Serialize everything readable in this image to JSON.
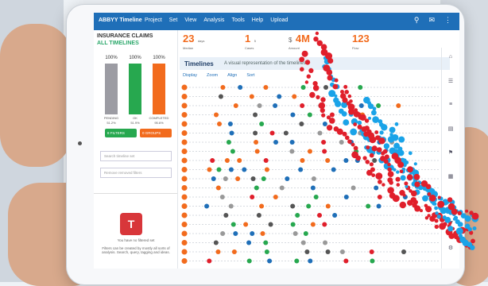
{
  "app": {
    "brand": "ABBYY Timeline",
    "menu": [
      "Project",
      "Set",
      "View",
      "Analysis",
      "Tools",
      "Help",
      "Upload"
    ]
  },
  "left_panel": {
    "title": "INSURANCE CLAIMS",
    "subtitle": "ALL TIMELINES",
    "bars": [
      {
        "pct": "100%",
        "label": "PENDING",
        "count": "51.2%",
        "color": "#9c9ca3",
        "fill": 1.0
      },
      {
        "pct": "100%",
        "label": "OK",
        "count": "51.9%",
        "color": "#27a84f",
        "fill": 1.0
      },
      {
        "pct": "100%",
        "label": "COMPLETED",
        "count": "95.6%",
        "color": "#f26b1d",
        "fill": 1.0
      }
    ],
    "filter_buttons": [
      {
        "label": "8 FILTERS",
        "color": "#27a84f"
      },
      {
        "label": "0 GROUPS",
        "color": "#f26b1d"
      }
    ],
    "search_placeholder": "Search timeline set",
    "remove_label": "Remove removed filters",
    "filter_note_title": "You have no filtered set",
    "filter_note_body": "Filters can be created by mostly all sorts of analysis. Search, query, tagging and ideas."
  },
  "kpis": [
    {
      "value": "23",
      "sub1": "days",
      "sub2": "AVG",
      "color": "#f26b1d",
      "caption": "Median"
    },
    {
      "value": "1",
      "sub1": "5",
      "sub2": "",
      "color": "#8aa",
      "caption": "Cases"
    },
    {
      "value": "4M",
      "sub1": "$",
      "sub2": "",
      "color": "#f26b1d",
      "caption": "Amount"
    },
    {
      "value": "123",
      "sub1": "",
      "sub2": "",
      "color": "#f26b1d",
      "caption": "Flow"
    }
  ],
  "timelines": {
    "title": "Timelines",
    "subtitle": "A visual representation of the timelines",
    "tools": [
      "Display",
      "Zoom",
      "Align",
      "Sort"
    ]
  },
  "right_nav": [
    "home-icon",
    "list-icon",
    "layers-icon",
    "chart-icon",
    "flag-icon",
    "grid-icon",
    "bell-icon",
    "filter-icon",
    "gear-icon"
  ],
  "colors": {
    "topbar": "#1f6fb8",
    "accent": "#f26b1d",
    "green": "#27a84f",
    "dot_red": "#e01f2b",
    "dot_blue": "#1aa3e8"
  }
}
